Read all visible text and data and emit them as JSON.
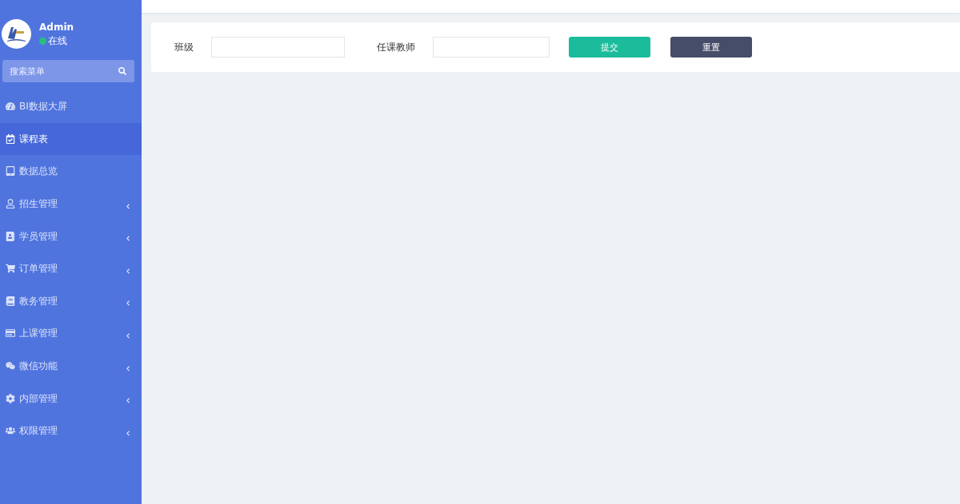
{
  "user": {
    "name": "Admin",
    "status": "在线",
    "online": true
  },
  "search": {
    "placeholder": "搜索菜单"
  },
  "menu": [
    {
      "label": "BI数据大屏",
      "kind": "link",
      "selected": false
    },
    {
      "label": "课程表",
      "kind": "link",
      "selected": true
    },
    {
      "label": "数据总览",
      "kind": "link",
      "selected": false
    },
    {
      "label": "招生管理",
      "kind": "submenu",
      "selected": false
    },
    {
      "label": "学员管理",
      "kind": "submenu",
      "selected": false
    },
    {
      "label": "订单管理",
      "kind": "submenu",
      "selected": false
    },
    {
      "label": "教务管理",
      "kind": "submenu",
      "selected": false
    },
    {
      "label": "上课管理",
      "kind": "submenu",
      "selected": false
    },
    {
      "label": "微信功能",
      "kind": "submenu",
      "selected": false
    },
    {
      "label": "内部管理",
      "kind": "submenu",
      "selected": false
    },
    {
      "label": "权限管理",
      "kind": "submenu",
      "selected": false
    }
  ],
  "form": {
    "fields": [
      {
        "label": "班级"
      },
      {
        "label": "任课教师"
      }
    ],
    "buttons": [
      {
        "label": "提交",
        "kind": "primary"
      },
      {
        "label": "重置",
        "kind": "secondary"
      }
    ]
  }
}
